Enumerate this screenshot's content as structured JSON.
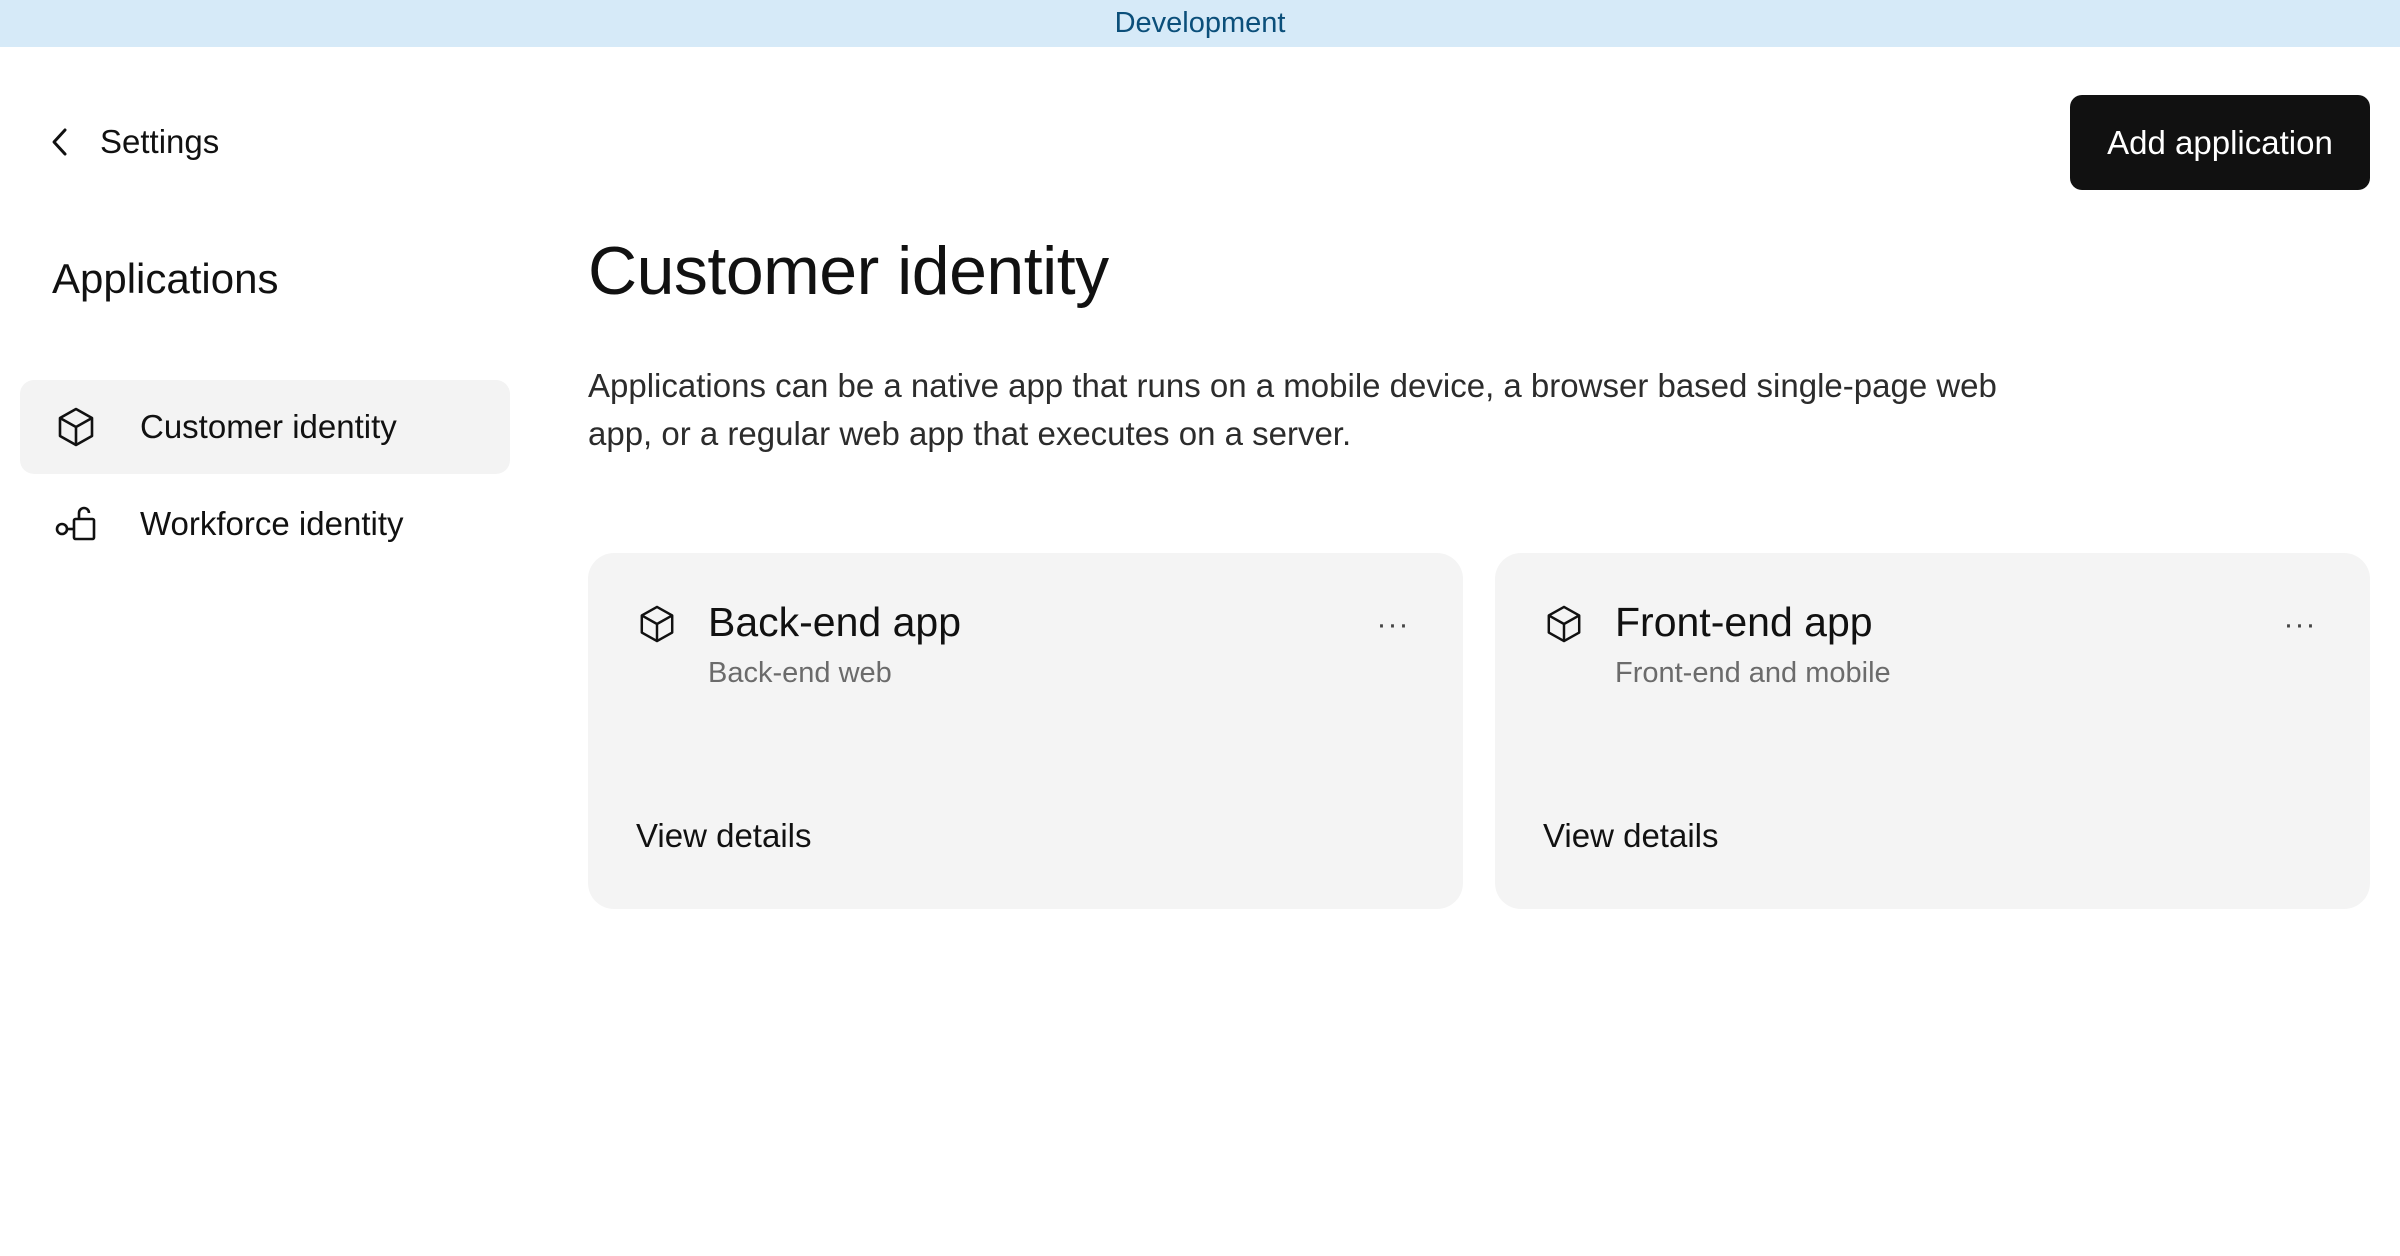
{
  "environment_banner": "Development",
  "back_link": {
    "label": "Settings",
    "icon": "chevron-left-icon"
  },
  "add_button": {
    "label": "Add application"
  },
  "sidebar": {
    "title": "Applications",
    "items": [
      {
        "label": "Customer identity",
        "icon": "cube-icon",
        "active": true
      },
      {
        "label": "Workforce identity",
        "icon": "workforce-icon",
        "active": false
      }
    ]
  },
  "main": {
    "title": "Customer identity",
    "description": "Applications can be a native app that runs on a mobile device, a browser based single-page web app, or a regular web app that executes on a server.",
    "cards": [
      {
        "title": "Back-end app",
        "subtitle": "Back-end web",
        "icon": "cube-icon",
        "menu": "···",
        "link": "View details"
      },
      {
        "title": "Front-end app",
        "subtitle": "Front-end and mobile",
        "icon": "cube-icon",
        "menu": "···",
        "link": "View details"
      }
    ]
  },
  "colors": {
    "banner_bg": "#d6eaf8",
    "banner_text": "#0b4f7a",
    "primary_button": "#111111",
    "card_bg": "#f4f4f4",
    "active_item_bg": "#f3f3f3"
  }
}
